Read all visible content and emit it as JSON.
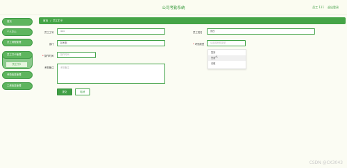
{
  "header": {
    "title": "公司考勤系统",
    "user": "员工 111",
    "logout": "退出登录"
  },
  "sidebar": {
    "items": [
      {
        "label": "首页"
      },
      {
        "label": "个人中心"
      },
      {
        "label": "员工请假管理"
      },
      {
        "label": "员工打卡管理"
      },
      {
        "label": "考勤信息管理"
      },
      {
        "label": "工资信息管理"
      }
    ],
    "sub_item": "员工打卡"
  },
  "breadcrumb": {
    "home": "首页",
    "sep": "/",
    "current": "员工打卡"
  },
  "form": {
    "employee_id_label": "员工工号",
    "employee_id_value": "111",
    "employee_name_label": "员工姓名",
    "employee_name_value": "张四",
    "department_label": "部门",
    "department_value": "技术部",
    "attendance_type_label": "考勤类型",
    "attendance_type_placeholder": "请选择考勤类型",
    "punch_time_label": "操作时间",
    "punch_time_placeholder": "操作时间",
    "remark_label": "考勤备注",
    "remark_placeholder": "考勤备注"
  },
  "dropdown": {
    "options": [
      "签到",
      "签退",
      "请假"
    ]
  },
  "buttons": {
    "submit": "提交",
    "cancel": "取消"
  },
  "watermark": "CSDN @CK3043"
}
